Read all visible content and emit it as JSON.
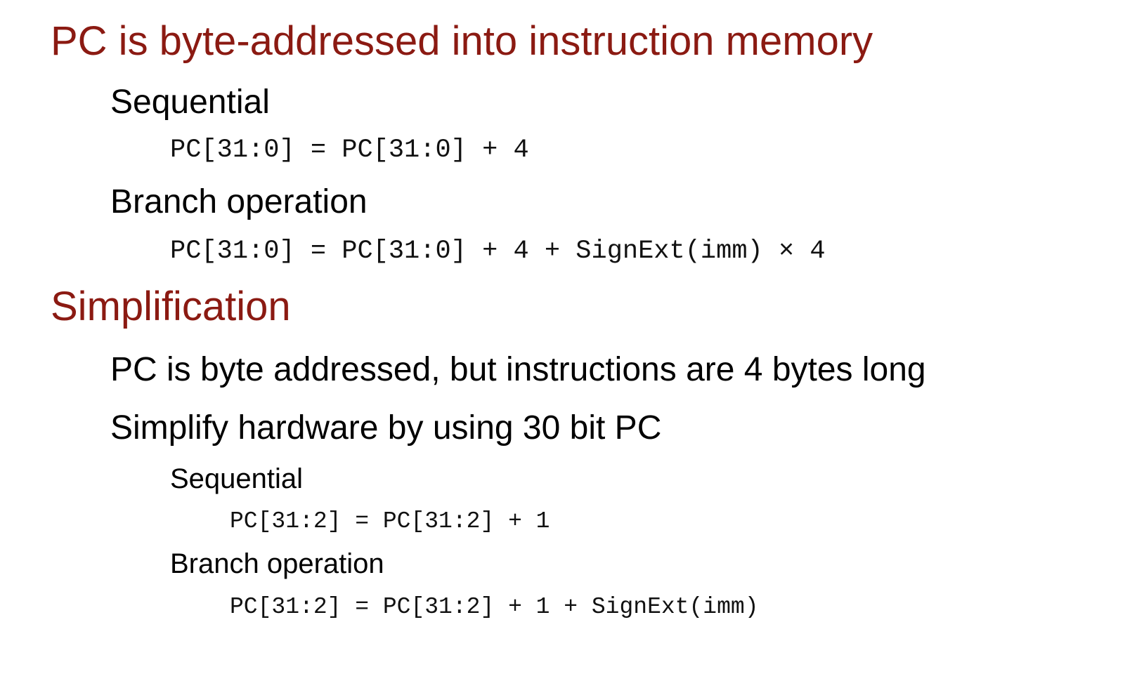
{
  "section1": {
    "heading": "PC is byte-addressed into instruction memory",
    "items": [
      {
        "label": "Sequential",
        "formula": "PC[31:0] = PC[31:0] + 4"
      },
      {
        "label": "Branch operation",
        "formula": "PC[31:0] = PC[31:0] + 4 + SignExt(imm) × 4"
      }
    ]
  },
  "section2": {
    "heading": "Simplification",
    "points": [
      "PC is byte addressed, but instructions are 4 bytes long",
      "Simplify hardware by using 30 bit PC"
    ],
    "subitems": [
      {
        "label": "Sequential",
        "formula": "PC[31:2] = PC[31:2] + 1"
      },
      {
        "label": "Branch operation",
        "formula": "PC[31:2] = PC[31:2] + 1 + SignExt(imm)"
      }
    ]
  },
  "colors": {
    "heading": "#8b1a12",
    "body": "#000000"
  }
}
